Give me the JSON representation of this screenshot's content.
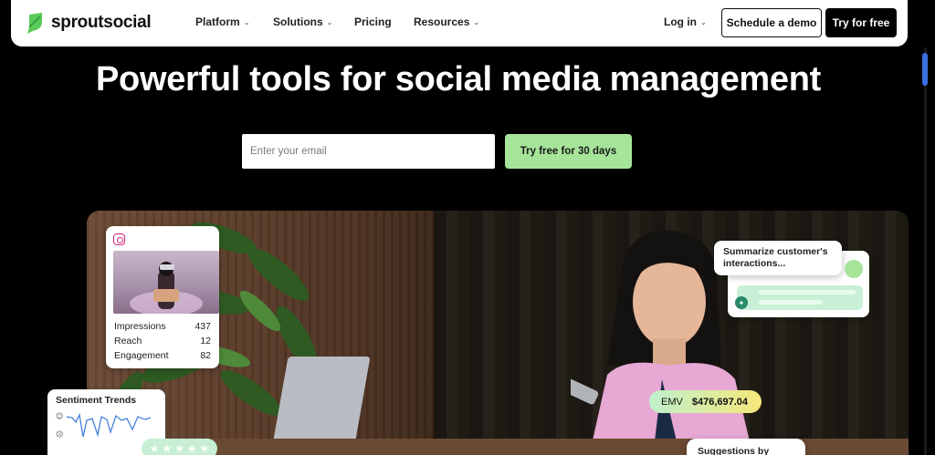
{
  "nav": {
    "brand": "sproutsocial",
    "items": [
      {
        "label": "Platform",
        "dropdown": true
      },
      {
        "label": "Solutions",
        "dropdown": true
      },
      {
        "label": "Pricing",
        "dropdown": false
      },
      {
        "label": "Resources",
        "dropdown": true
      }
    ],
    "login": "Log in",
    "demo": "Schedule a demo",
    "try": "Try for free"
  },
  "hero": {
    "title": "Powerful tools for social media management",
    "email_placeholder": "Enter your email",
    "cta": "Try free for 30 days"
  },
  "instagram_card": {
    "icon": "instagram-icon",
    "stats": [
      {
        "label": "Impressions",
        "value": "437"
      },
      {
        "label": "Reach",
        "value": "12"
      },
      {
        "label": "Engagement",
        "value": "82"
      }
    ]
  },
  "ai_card": {
    "prompt": "Summarize customer's interactions..."
  },
  "emv": {
    "label": "EMV",
    "value": "$476,697.04"
  },
  "sentiment": {
    "title": "Sentiment Trends"
  },
  "suggestions": {
    "title": "Suggestions by"
  },
  "colors": {
    "accent_green": "#a6e49a",
    "brand_green": "#59cb59",
    "instagram_pink": "#d6247a"
  }
}
